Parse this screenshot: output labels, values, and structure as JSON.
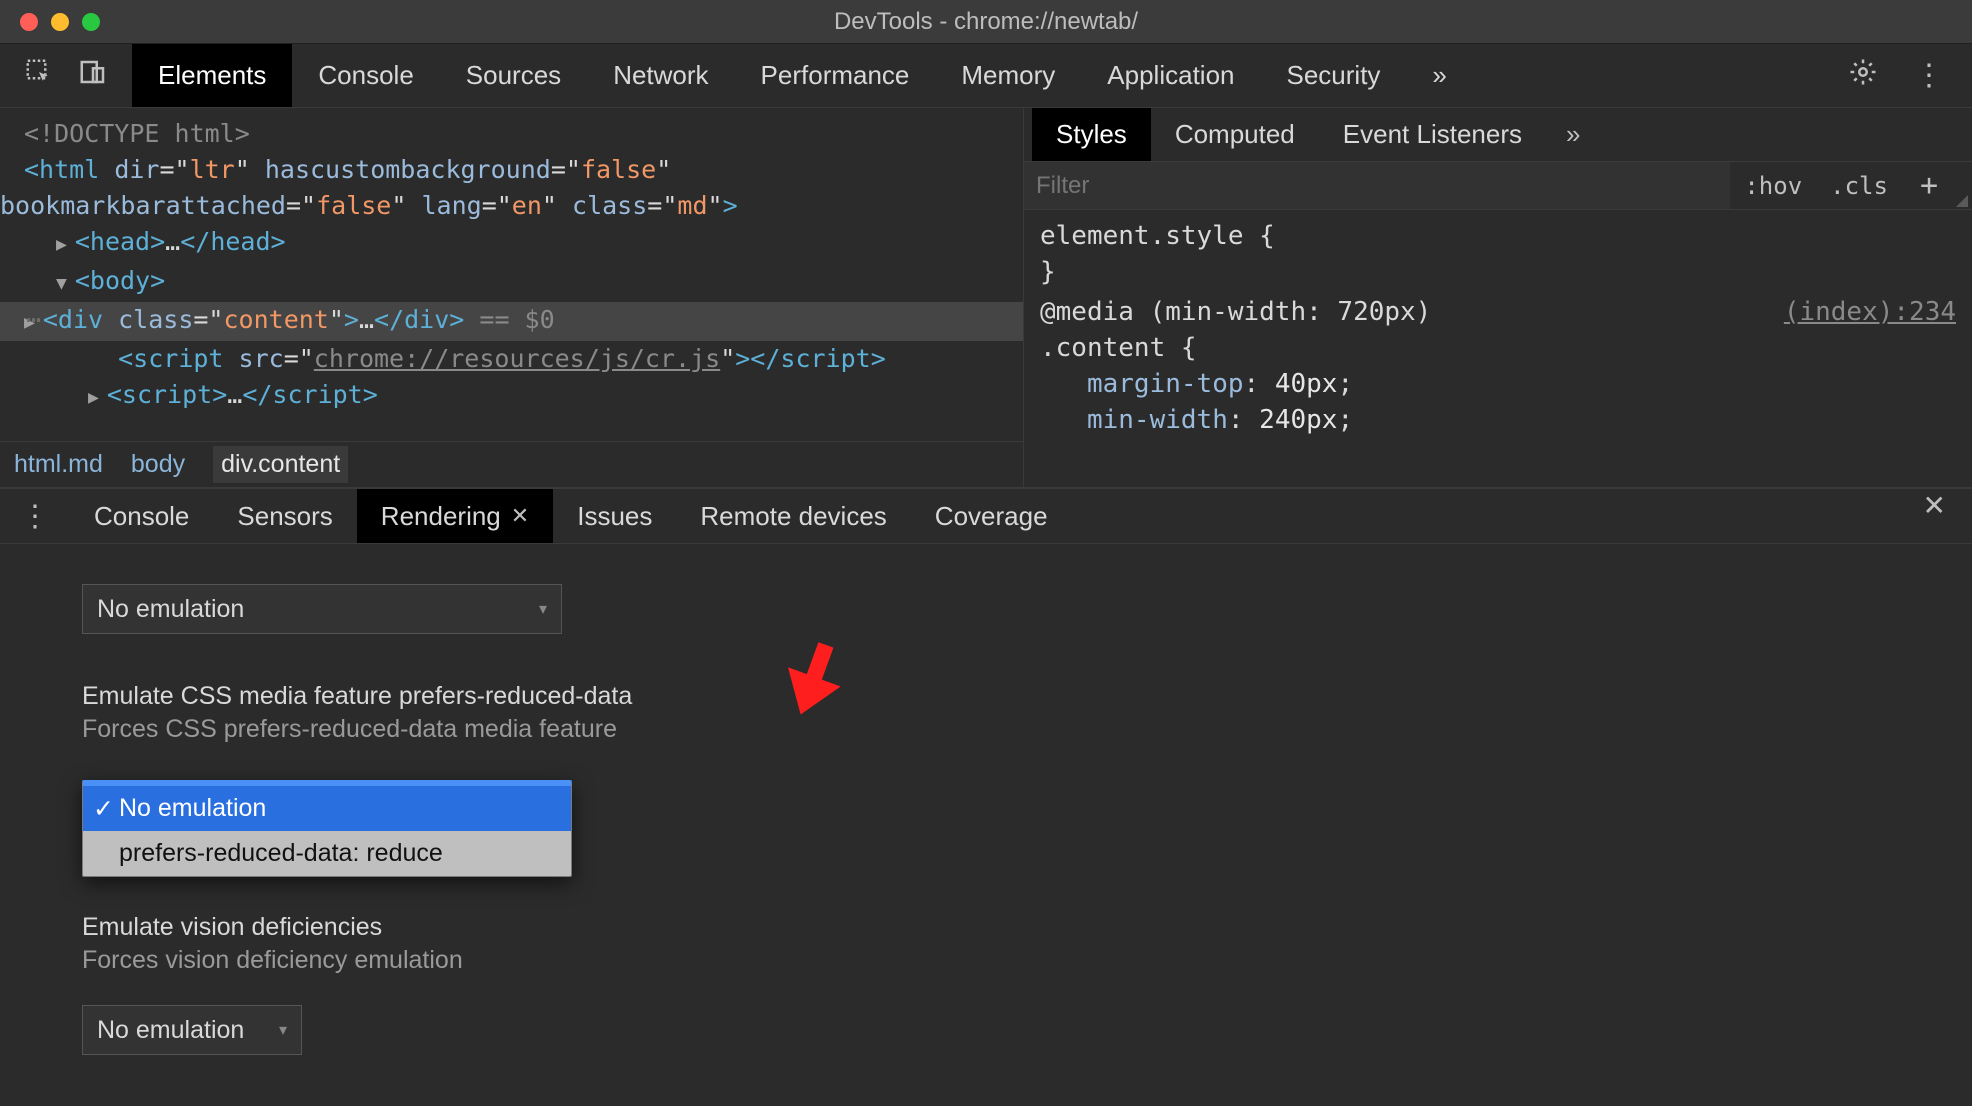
{
  "window": {
    "title": "DevTools - chrome://newtab/"
  },
  "main_tabs": {
    "items": [
      "Elements",
      "Console",
      "Sources",
      "Network",
      "Performance",
      "Memory",
      "Application",
      "Security"
    ],
    "active": "Elements",
    "more": "»"
  },
  "dom": {
    "doctype": "<!DOCTYPE html>",
    "html_open_1": "<html dir=\"ltr\" hascustombackground=\"false\"",
    "html_open_2": "bookmarkbarattached=\"false\" lang=\"en\" class=\"md\">",
    "head": "<head>…</head>",
    "body_open": "<body>",
    "selected": "<div class=\"content\">…</div>",
    "selected_suffix": " == $0",
    "script1": "<script src=\"chrome://resources/js/cr.js\"></scr",
    "script1_b": "ipt>",
    "script2": "<script>…</scr",
    "script2_b": "ipt>"
  },
  "breadcrumb": {
    "items": [
      "html.md",
      "body",
      "div.content"
    ],
    "active": "div.content"
  },
  "styles": {
    "tabs": [
      "Styles",
      "Computed",
      "Event Listeners"
    ],
    "active": "Styles",
    "more": "»",
    "filter_placeholder": "Filter",
    "hov": ":hov",
    "cls": ".cls",
    "element_style": "element.style {",
    "close_brace": "}",
    "media": "@media (min-width: 720px)",
    "selector": ".content {",
    "source": "(index):234",
    "decl1_prop": "margin-top",
    "decl1_val": "40px",
    "decl2_prop": "min-width",
    "decl2_val": "240px"
  },
  "drawer": {
    "tabs": [
      "Console",
      "Sensors",
      "Rendering",
      "Issues",
      "Remote devices",
      "Coverage"
    ],
    "active": "Rendering",
    "select1_value": "No emulation",
    "section1_title": "Emulate CSS media feature prefers-reduced-data",
    "section1_desc": "Forces CSS prefers-reduced-data media feature",
    "dropdown_options": [
      "No emulation",
      "prefers-reduced-data: reduce"
    ],
    "dropdown_selected": "No emulation",
    "section2_title": "Emulate vision deficiencies",
    "section2_desc": "Forces vision deficiency emulation",
    "select2_value": "No emulation"
  }
}
